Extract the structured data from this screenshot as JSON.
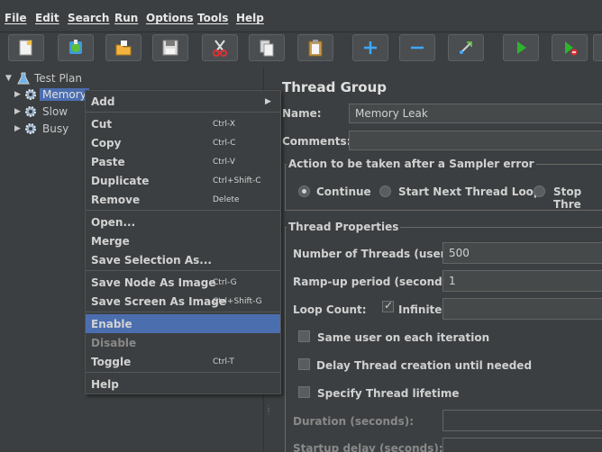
{
  "menubar": [
    "File",
    "Edit",
    "Search",
    "Run",
    "Options",
    "Tools",
    "Help"
  ],
  "toolbar": {
    "icons": [
      "new-icon",
      "templates-icon",
      "open-icon",
      "save-icon",
      "cut-icon",
      "copy-icon",
      "paste-icon",
      "expand-icon",
      "collapse-icon",
      "toggle-icon",
      "start-icon",
      "start-no-pauses-icon"
    ]
  },
  "tree": {
    "root": "Test Plan",
    "items": [
      "Memory",
      "Slow",
      "Busy"
    ]
  },
  "context_menu": {
    "items": [
      {
        "label": "Add",
        "shortcut": "",
        "submenu": true
      },
      {
        "label": "Cut",
        "shortcut": "Ctrl-X"
      },
      {
        "label": "Copy",
        "shortcut": "Ctrl-C"
      },
      {
        "label": "Paste",
        "shortcut": "Ctrl-V"
      },
      {
        "label": "Duplicate",
        "shortcut": "Ctrl+Shift-C"
      },
      {
        "label": "Remove",
        "shortcut": "Delete"
      },
      {
        "label": "Open...",
        "shortcut": ""
      },
      {
        "label": "Merge",
        "shortcut": ""
      },
      {
        "label": "Save Selection As...",
        "shortcut": ""
      },
      {
        "label": "Save Node As Image",
        "shortcut": "Ctrl-G"
      },
      {
        "label": "Save Screen As Image",
        "shortcut": "Ctrl+Shift-G"
      },
      {
        "label": "Enable",
        "shortcut": "",
        "highlighted": true
      },
      {
        "label": "Disable",
        "shortcut": "",
        "disabled": true
      },
      {
        "label": "Toggle",
        "shortcut": "Ctrl-T"
      },
      {
        "label": "Help",
        "shortcut": ""
      }
    ]
  },
  "panel": {
    "title": "Thread Group",
    "name_label": "Name:",
    "name_value": "Memory Leak",
    "comments_label": "Comments:",
    "comments_value": "",
    "error_action_legend": "Action to be taken after a Sampler error",
    "error_options": [
      "Continue",
      "Start Next Thread Loop",
      "Stop Thre"
    ],
    "error_selected": "Continue",
    "thread_props_legend": "Thread Properties",
    "threads_label": "Number of Threads (users):",
    "threads_value": "500",
    "rampup_label": "Ramp-up period (seconds):",
    "rampup_value": "1",
    "loop_label": "Loop Count:",
    "infinite_label": "Infinite",
    "infinite_checked": true,
    "loop_value": "",
    "same_user_label": "Same user on each iteration",
    "delay_label": "Delay Thread creation until needed",
    "lifetime_label": "Specify Thread lifetime",
    "duration_label": "Duration (seconds):",
    "startup_label": "Startup delay (seconds):"
  },
  "colors": {
    "background": "#3c3f41",
    "selection": "#4b6eaf",
    "start_green": "#2fb32f"
  }
}
